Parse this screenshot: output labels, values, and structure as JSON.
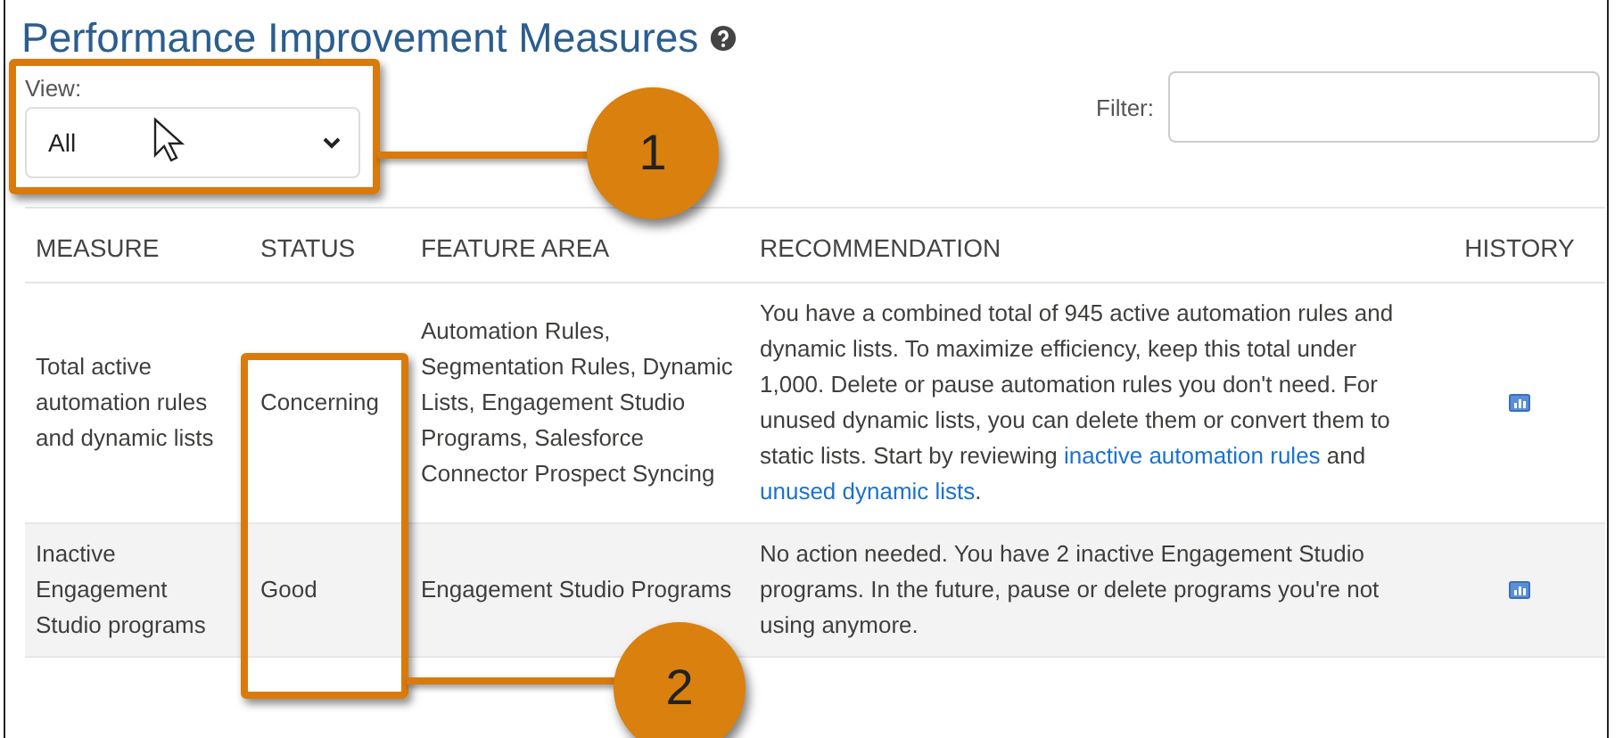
{
  "title": "Performance Improvement Measures",
  "view": {
    "label": "View:",
    "value": "All"
  },
  "filter": {
    "label": "Filter:"
  },
  "table": {
    "columns": [
      "MEASURE",
      "STATUS",
      "FEATURE AREA",
      "RECOMMENDATION",
      "HISTORY"
    ],
    "rows": [
      {
        "measure": "Total active automation rules and dynamic lists",
        "status": "Concerning",
        "feature_area": "Automation Rules, Segmentation Rules, Dynamic Lists, Engagement Studio Programs, Salesforce Connector Prospect Syncing",
        "recommendation": [
          {
            "kind": "text",
            "text": "You have a combined total of 945 active automation rules and dynamic lists. To maximize efficiency, keep this total under 1,000. Delete or pause automation rules you don't need. For unused dynamic lists, you can delete them or convert them to static lists. Start by reviewing "
          },
          {
            "kind": "link",
            "text": "inactive automation rules"
          },
          {
            "kind": "text",
            "text": " and "
          },
          {
            "kind": "link",
            "text": "unused dynamic lists"
          },
          {
            "kind": "text",
            "text": "."
          }
        ]
      },
      {
        "measure": "Inactive Engagement Studio programs",
        "status": "Good",
        "feature_area": "Engagement Studio Programs",
        "recommendation": [
          {
            "kind": "text",
            "text": "No action needed. You have 2 inactive Engagement Studio programs. In the future, pause or delete programs you're not using anymore."
          }
        ]
      }
    ]
  },
  "callouts": [
    {
      "label": "1"
    },
    {
      "label": "2"
    }
  ]
}
